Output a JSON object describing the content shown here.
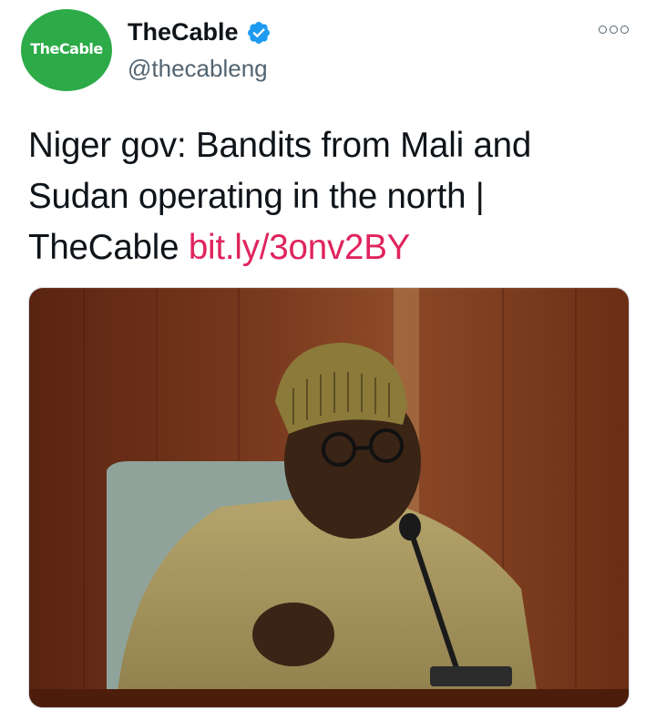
{
  "tweet": {
    "author": {
      "avatar_text": "TheCable",
      "display_name": "TheCable",
      "handle": "@thecableng",
      "verified": true
    },
    "text": "Niger gov: Bandits from Mali and Sudan operating in the north | TheCable ",
    "link": "bit.ly/3onv2BY",
    "link_color": "#e0245e",
    "media": {
      "description_icon": "photo-media"
    }
  },
  "colors": {
    "avatar_bg": "#2cab48",
    "verified": "#1d9bf0",
    "text": "#0f1419",
    "secondary": "#536471"
  }
}
